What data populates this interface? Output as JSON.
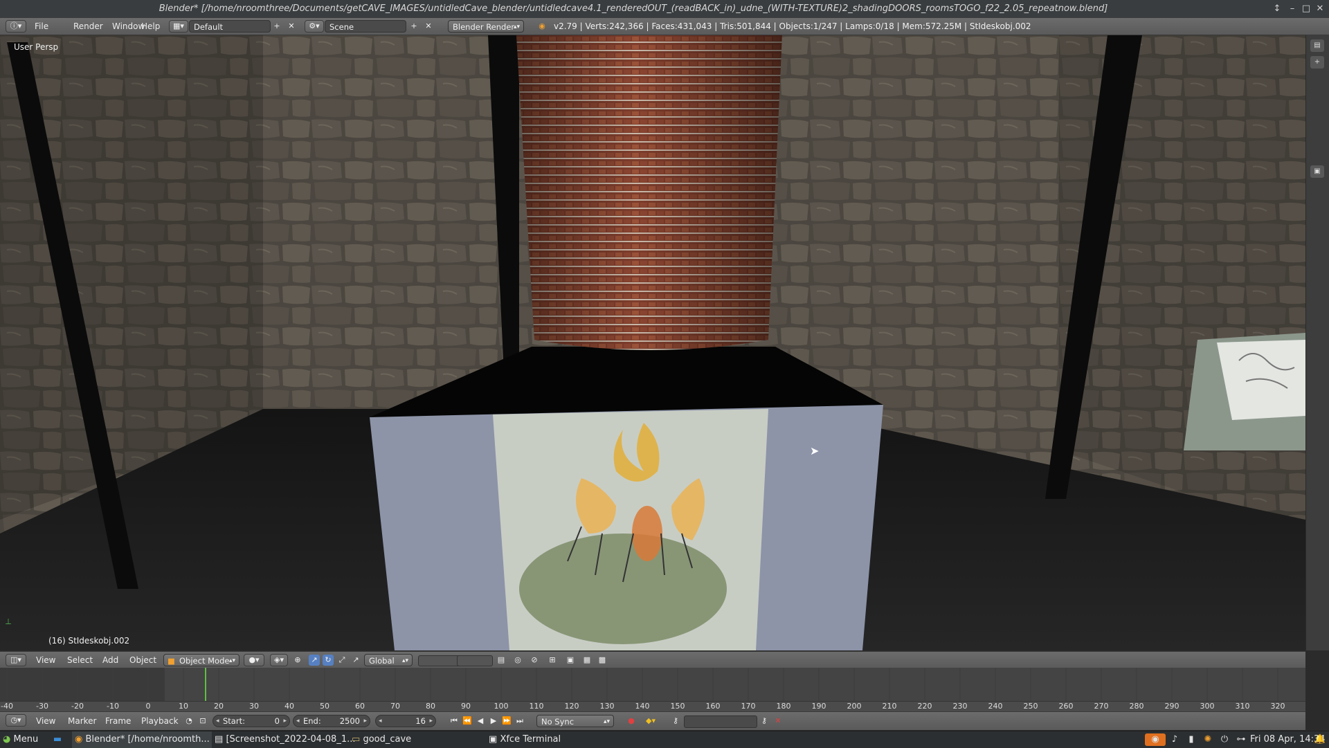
{
  "window": {
    "title": "Blender* [/home/nroomthree/Documents/getCAVE_IMAGES/untidledCave_blender/untidledcave4.1_renderedOUT_(readBACK_in)_udne_(WITH-TEXTURE)2_shadingDOORS_roomsTOGO_f22_2.05_repeatnow.blend]"
  },
  "info_header": {
    "menus": [
      "File",
      "Render",
      "Window",
      "Help"
    ],
    "screen_layout": "Default",
    "scene": "Scene",
    "render_engine": "Blender Render",
    "stats": "v2.79 | Verts:242,366 | Faces:431,043 | Tris:501,844 | Objects:1/247 | Lamps:0/18 | Mem:572.25M | StIdeskobj.002"
  },
  "viewport": {
    "view_label": "User Persp",
    "object_info": "(16) StIdeskobj.002",
    "colors": {
      "wall": "#4a4540",
      "floor": "#1e1e1e",
      "cylinder": "#8a4a36",
      "box": "#8d94a8"
    }
  },
  "view_header": {
    "menus": [
      "View",
      "Select",
      "Add",
      "Object"
    ],
    "mode": "Object Mode",
    "orientation": "Global"
  },
  "timeline": {
    "ticks": [
      "-40",
      "-30",
      "-20",
      "-10",
      "0",
      "10",
      "20",
      "30",
      "40",
      "50",
      "60",
      "70",
      "80",
      "90",
      "100",
      "110",
      "120",
      "130",
      "140",
      "150",
      "160",
      "170",
      "180",
      "190",
      "200",
      "210",
      "220",
      "230",
      "240",
      "250",
      "260",
      "270",
      "280",
      "290",
      "300",
      "310",
      "320"
    ],
    "current_frame": 16
  },
  "timeline_header": {
    "menus": [
      "View",
      "Marker",
      "Frame",
      "Playback"
    ],
    "start_label": "Start:",
    "start_value": "0",
    "end_label": "End:",
    "end_value": "2500",
    "current": "16",
    "sync": "No Sync"
  },
  "taskbar": {
    "menu": "Menu",
    "tasks": [
      "Blender* [/home/nroomth...",
      "[Screenshot_2022-04-08_1...",
      "good_cave",
      "Xfce Terminal"
    ],
    "clock": "Fri 08 Apr, 14:34"
  }
}
